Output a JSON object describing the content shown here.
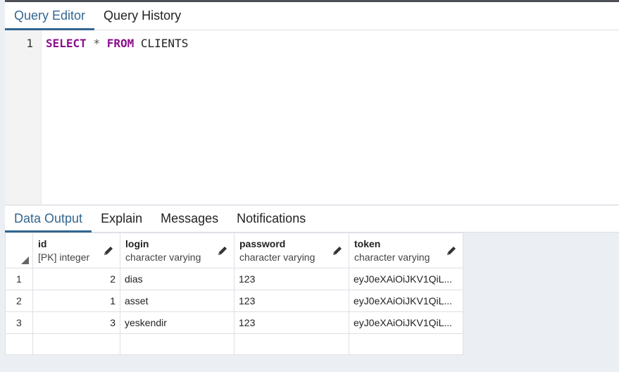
{
  "query_tabs": [
    {
      "label": "Query Editor",
      "active": true
    },
    {
      "label": "Query History",
      "active": false
    }
  ],
  "editor": {
    "line_number": "1",
    "tokens": {
      "select": "SELECT",
      "star": "*",
      "from": "FROM",
      "table": "CLIENTS"
    }
  },
  "output_tabs": [
    {
      "label": "Data Output",
      "active": true
    },
    {
      "label": "Explain",
      "active": false
    },
    {
      "label": "Messages",
      "active": false
    },
    {
      "label": "Notifications",
      "active": false
    }
  ],
  "grid": {
    "columns": [
      {
        "name": "id",
        "type": "[PK] integer"
      },
      {
        "name": "login",
        "type": "character varying"
      },
      {
        "name": "password",
        "type": "character varying"
      },
      {
        "name": "token",
        "type": "character varying"
      }
    ],
    "rows": [
      {
        "num": "1",
        "id": "2",
        "login": "dias",
        "password": "123",
        "token": "eyJ0eXAiOiJKV1QiL..."
      },
      {
        "num": "2",
        "id": "1",
        "login": "asset",
        "password": "123",
        "token": "eyJ0eXAiOiJKV1QiL..."
      },
      {
        "num": "3",
        "id": "3",
        "login": "yeskendir",
        "password": "123",
        "token": "eyJ0eXAiOiJKV1QiL..."
      }
    ]
  },
  "colors": {
    "accent": "#326690",
    "keyword": "#8c0f8e"
  }
}
